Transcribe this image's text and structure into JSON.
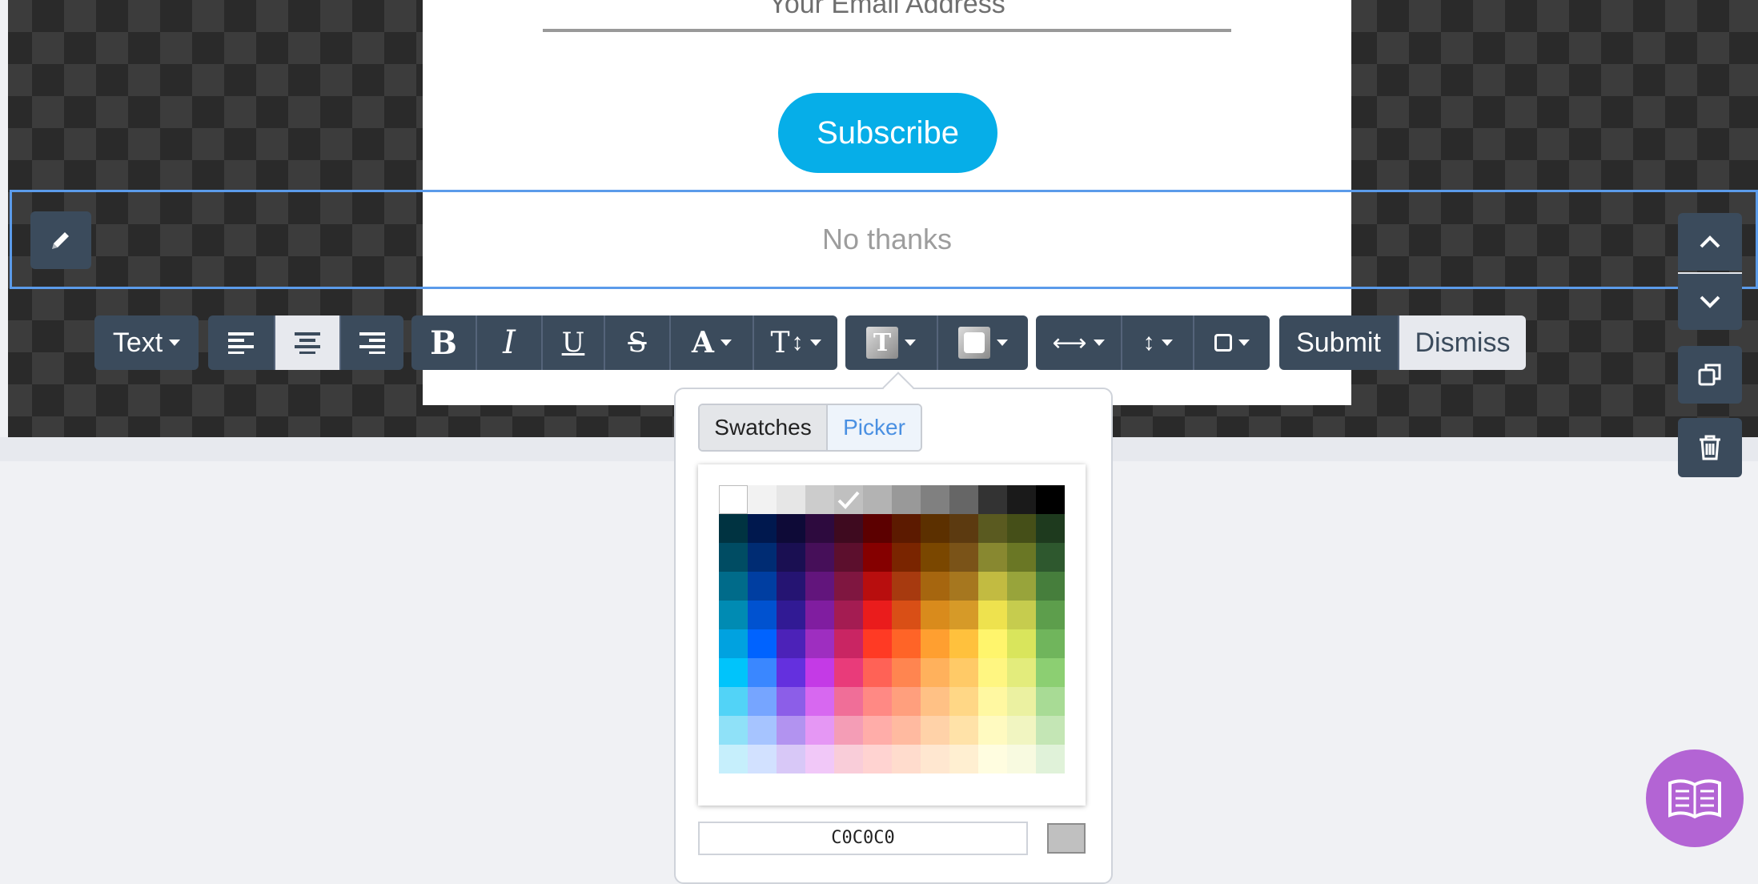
{
  "popup": {
    "email_placeholder": "Your Email Address",
    "subscribe_label": "Subscribe",
    "no_thanks_label": "No thanks"
  },
  "toolbar": {
    "element_type": "Text",
    "bold_glyph": "B",
    "italic_glyph": "I",
    "underline_glyph": "U",
    "strike_glyph": "S",
    "font_glyph": "A",
    "size_glyph": "T",
    "text_color_glyph": "T",
    "submit_label": "Submit",
    "dismiss_label": "Dismiss",
    "active_alignment": "center"
  },
  "color_picker": {
    "tabs": [
      "Swatches",
      "Picker"
    ],
    "active_tab": "Swatches",
    "hex_value": "C0C0C0",
    "selected_color": "#c0c0c0",
    "swatch_rows": [
      [
        "#ffffff",
        "#f2f2f2",
        "#e6e6e6",
        "#cccccc",
        "#c0c0c0",
        "#b3b3b3",
        "#999999",
        "#808080",
        "#666666",
        "#333333",
        "#1a1a1a",
        "#000000"
      ],
      [
        "#003341",
        "#00184e",
        "#0e0a37",
        "#2d0a3e",
        "#3e0a1f",
        "#5c0000",
        "#5c1a00",
        "#5c3000",
        "#5c3a10",
        "#5a5a20",
        "#454f18",
        "#1e3a1e"
      ],
      [
        "#004c63",
        "#002c73",
        "#1a0f52",
        "#460f59",
        "#5c0f2d",
        "#850000",
        "#7a2500",
        "#7a4700",
        "#7a5318",
        "#888830",
        "#6a7725",
        "#2e582e"
      ],
      [
        "#006b8a",
        "#003ea1",
        "#251472",
        "#62157c",
        "#7f1640",
        "#b80e0e",
        "#a73a0f",
        "#a6660f",
        "#a6771f",
        "#c2bb41",
        "#98a43b",
        "#467e3c"
      ],
      [
        "#008bb3",
        "#0052d0",
        "#311a94",
        "#801da0",
        "#a41c52",
        "#ea1c1c",
        "#d94f16",
        "#d98b1c",
        "#d69a28",
        "#eee24e",
        "#c6cc4e",
        "#5d9e4c"
      ],
      [
        "#00a2e0",
        "#0063ff",
        "#4c22b8",
        "#9e2ec0",
        "#c92563",
        "#ff3a24",
        "#ff6427",
        "#ff9f30",
        "#ffc13d",
        "#fff56c",
        "#d9e55c",
        "#70b55c"
      ],
      [
        "#00c4fb",
        "#3a87ff",
        "#6430de",
        "#c43ae6",
        "#e93b7a",
        "#ff6256",
        "#ff8550",
        "#ffb15c",
        "#ffca67",
        "#fff681",
        "#e3ec7c",
        "#8ccf72"
      ],
      [
        "#52d3f7",
        "#76a5ff",
        "#8c5ee8",
        "#d768f0",
        "#f06e98",
        "#ff8984",
        "#ff9f7d",
        "#ffc185",
        "#ffd786",
        "#fff8a1",
        "#ebf1a1",
        "#a8db95"
      ],
      [
        "#8fe1f8",
        "#a6c4ff",
        "#b293f0",
        "#e597f4",
        "#f49db6",
        "#ffada9",
        "#ffbaa0",
        "#ffd2a8",
        "#ffe2a8",
        "#fffac0",
        "#f1f5c1",
        "#c4e6b5"
      ],
      [
        "#c6effc",
        "#d2e1ff",
        "#d8c8f7",
        "#f1c8f8",
        "#f9cdd9",
        "#ffd3d1",
        "#ffdccd",
        "#ffe7d0",
        "#ffefd1",
        "#fffde0",
        "#f8fae0",
        "#e0f2d9"
      ]
    ],
    "selected_row": 0,
    "selected_col": 4
  },
  "colors": {
    "accent": "#06aee8",
    "toolbar_bg": "#3b4b5c",
    "selection": "#5b9bea",
    "fab": "#b364d4"
  },
  "icons": {
    "edit": "pencil-icon",
    "move_up": "chevron-up-icon",
    "move_down": "chevron-down-icon",
    "duplicate": "copy-icon",
    "delete": "trash-icon",
    "help": "book-icon"
  }
}
